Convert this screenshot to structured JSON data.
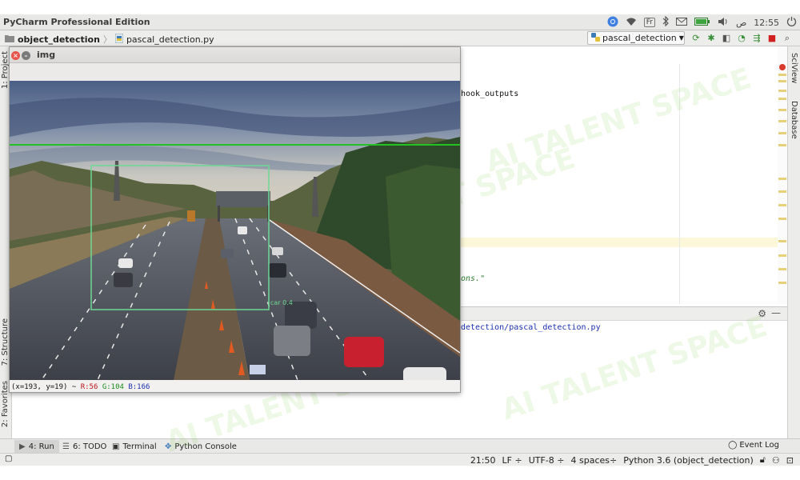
{
  "app_title": "PyCharm Professional Edition",
  "system_tray": {
    "input_method": "Fr",
    "keyboard_layout": "ص",
    "clock": "12:55"
  },
  "navbar": {
    "project": "object_detection",
    "file": "pascal_detection.py",
    "run_configuration": "pascal_detection"
  },
  "left_tool_tabs": [
    "1: Project",
    "7: Structure",
    "2: Favorites"
  ],
  "right_tool_tabs": [
    "SciView",
    "Database"
  ],
  "editor": {
    "visible_fragments": [
      "hook_outputs",
      "ons.\""
    ]
  },
  "run_panel": {
    "output_line": "detection/pascal_detection.py"
  },
  "bottom_tool_windows": [
    {
      "label": "4: Run",
      "icon": "play-icon",
      "active": true
    },
    {
      "label": "6: TODO",
      "icon": "list-icon",
      "active": false
    },
    {
      "label": "Terminal",
      "icon": "terminal-icon",
      "active": false
    },
    {
      "label": "Python Console",
      "icon": "python-icon",
      "active": false
    }
  ],
  "event_log": "Event Log",
  "status_bar": {
    "position": "21:50",
    "line_separator": "LF",
    "encoding": "UTF-8",
    "indent": "4 spaces",
    "interpreter": "Python 3.6 (object_detection)"
  },
  "image_window": {
    "title": "img",
    "coords": "(x=193, y=19) ~ ",
    "r": "R:56",
    "g": "G:104",
    "b": "B:166",
    "detections": [
      {
        "label": "green-line",
        "color": "#22c222"
      },
      {
        "label": "car-box",
        "color": "#6ed894",
        "score_text": "car 0.4"
      }
    ]
  },
  "watermark": "AI TALENT SPACE"
}
